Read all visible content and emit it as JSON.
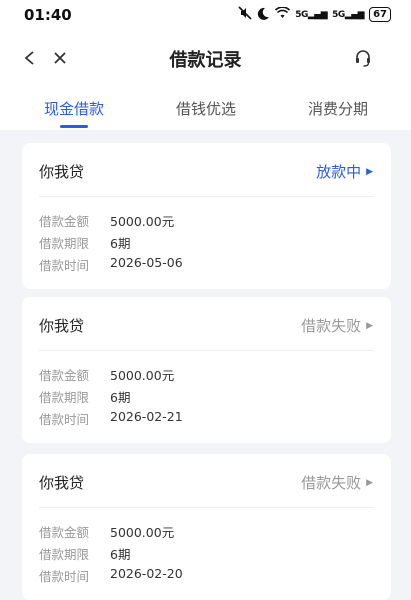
{
  "status_bar": {
    "time": "01:40",
    "signal1": "5G",
    "signal2": "5G",
    "battery": "67"
  },
  "header": {
    "title": "借款记录"
  },
  "tabs": [
    {
      "label": "现金借款",
      "active": true
    },
    {
      "label": "借钱优选",
      "active": false
    },
    {
      "label": "消费分期",
      "active": false
    }
  ],
  "records": [
    {
      "lender": "你我贷",
      "status": "放款中",
      "amount_label": "借款金额",
      "amount": "5000.00元",
      "term_label": "借款期限",
      "term": "6期",
      "date_label": "借款时间",
      "date": "2026-05-06"
    },
    {
      "lender": "你我贷",
      "status": "借款失败",
      "amount_label": "借款金额",
      "amount": "5000.00元",
      "term_label": "借款期限",
      "term": "6期",
      "date_label": "借款时间",
      "date": "2026-02-21"
    },
    {
      "lender": "你我贷",
      "status": "借款失败",
      "amount_label": "借款金额",
      "amount": "5000.00元",
      "term_label": "借款期限",
      "term": "6期",
      "date_label": "借款时间",
      "date": "2026-02-20"
    }
  ],
  "colors": {
    "accent": "#2b5fd9",
    "failed": "#999999",
    "background": "#f3f4f8"
  }
}
